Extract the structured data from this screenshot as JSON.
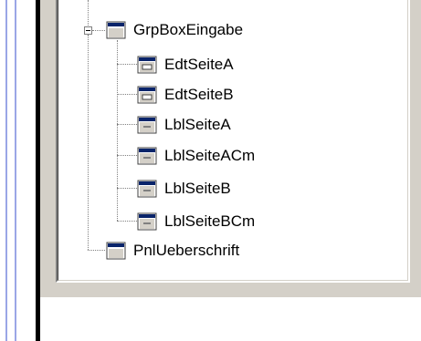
{
  "tree": {
    "group": {
      "label": "GrpBoxEingabe",
      "icon": "groupbox-icon",
      "expanded": true
    },
    "children": [
      {
        "label": "EdtSeiteA",
        "icon": "edit-control-icon"
      },
      {
        "label": "EdtSeiteB",
        "icon": "edit-control-icon"
      },
      {
        "label": "LblSeiteA",
        "icon": "label-control-icon"
      },
      {
        "label": "LblSeiteACm",
        "icon": "label-control-icon"
      },
      {
        "label": "LblSeiteB",
        "icon": "label-control-icon"
      },
      {
        "label": "LblSeiteBCm",
        "icon": "label-control-icon"
      }
    ],
    "sibling": {
      "label": "PnlUeberschrift",
      "icon": "panel-icon"
    }
  },
  "colors": {
    "window_face": "#d4d0c8",
    "title_blue": "#0a246a",
    "edge_blue": "#9aa6e6"
  }
}
